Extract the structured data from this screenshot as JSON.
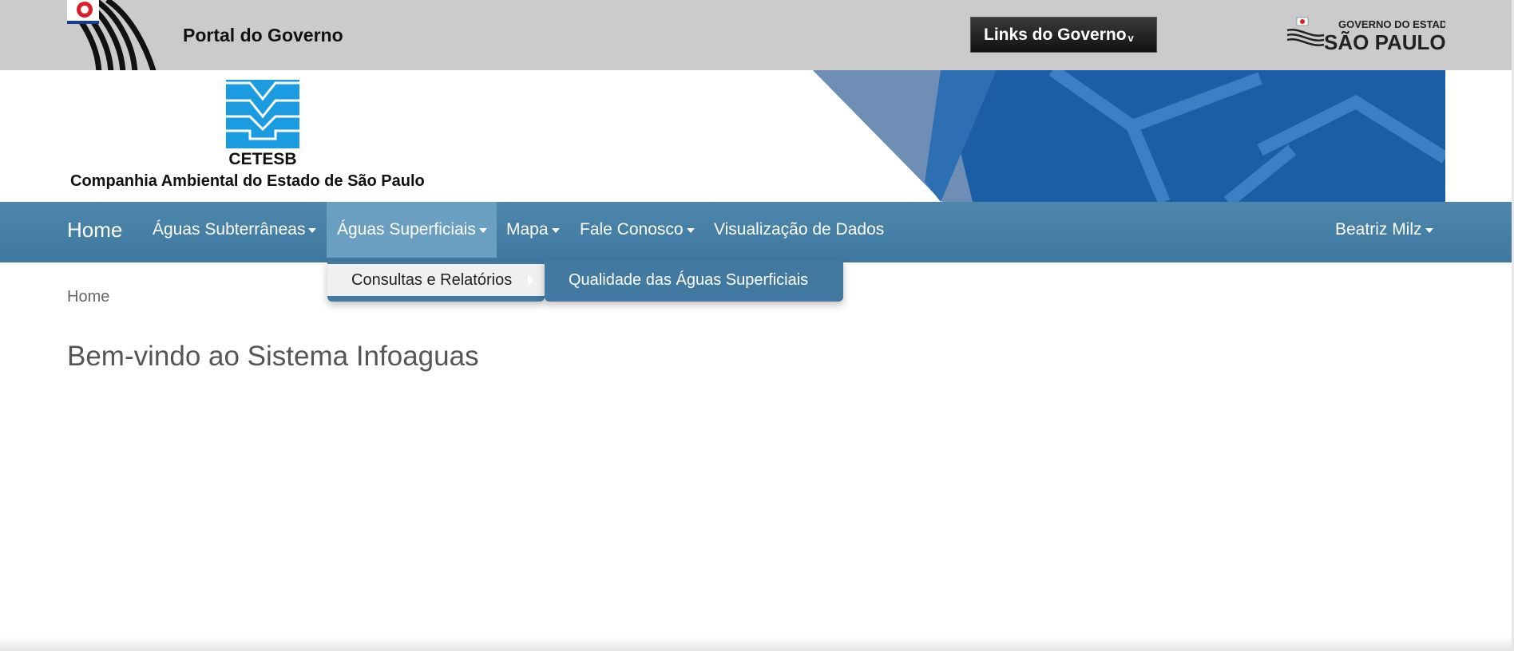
{
  "gov_bar": {
    "portal_label": "Portal do Governo",
    "links_label": "Links do Governo",
    "links_caret": "v",
    "sp_logo_line1": "GOVERNO DO ESTADO",
    "sp_logo_line2": "SÃO PAULO"
  },
  "banner": {
    "org_short": "CETESB",
    "org_full": "Companhia Ambiental do Estado de São Paulo"
  },
  "navbar": {
    "brand": "Home",
    "items": [
      {
        "label": "Águas Subterrâneas",
        "has_caret": true
      },
      {
        "label": "Águas Superficiais",
        "has_caret": true,
        "active": true
      },
      {
        "label": "Mapa",
        "has_caret": true
      },
      {
        "label": "Fale Conosco",
        "has_caret": true
      },
      {
        "label": "Visualização de Dados",
        "has_caret": false
      }
    ],
    "user": "Beatriz Milz"
  },
  "dropdown": {
    "item": "Consultas e Relatórios",
    "submenu_item": "Qualidade das Águas Superficiais"
  },
  "content": {
    "breadcrumb": "Home",
    "title": "Bem-vindo ao Sistema Infoaguas"
  },
  "colors": {
    "navbar": "#4179a0",
    "nav_active": "#6a9fc1",
    "gov_bar": "#cbcbcb",
    "cetesb_blue": "#1c9ce0"
  }
}
